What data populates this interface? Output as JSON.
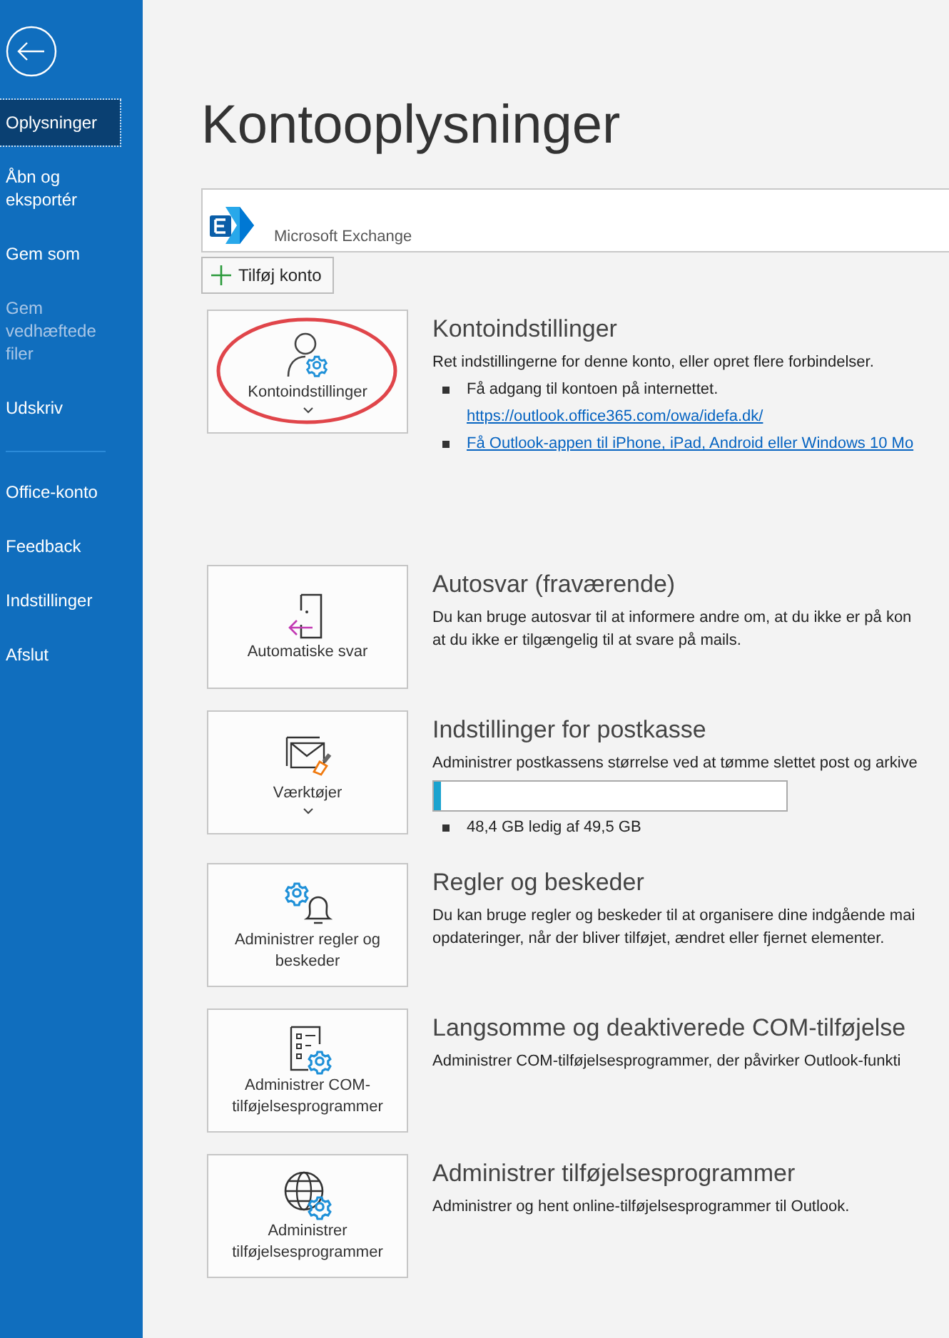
{
  "sidebar": {
    "items": [
      {
        "label": "Oplysninger",
        "selected": true,
        "disabled": false
      },
      {
        "label": "Åbn og eksportér",
        "selected": false,
        "disabled": false
      },
      {
        "label": "Gem som",
        "selected": false,
        "disabled": false
      },
      {
        "label": "Gem vedhæftede filer",
        "selected": false,
        "disabled": true
      },
      {
        "label": "Udskriv",
        "selected": false,
        "disabled": false
      }
    ],
    "bottom_items": [
      {
        "label": "Office-konto",
        "selected": false,
        "disabled": false
      },
      {
        "label": "Feedback",
        "selected": false,
        "disabled": false
      },
      {
        "label": "Indstillinger",
        "selected": false,
        "disabled": false
      },
      {
        "label": "Afslut",
        "selected": false,
        "disabled": false
      }
    ]
  },
  "page_title": "Kontooplysninger",
  "account": {
    "type": "Microsoft Exchange"
  },
  "add_account_button": "Tilføj konto",
  "sections": [
    {
      "kind": "account_settings",
      "button": {
        "label": "Kontoindstillinger",
        "dropdown": true,
        "highlighted": true
      },
      "heading": "Kontoindstillinger",
      "description": "Ret indstillingerne for denne konto, eller opret flere forbindelser.",
      "bullets": [
        {
          "text": "Få adgang til kontoen på internettet.",
          "link": "https://outlook.office365.com/owa/idefa.dk/"
        },
        {
          "link": "Få Outlook-appen til iPhone, iPad, Android eller Windows 10 Mo"
        }
      ]
    },
    {
      "kind": "auto_reply",
      "button": {
        "label": "Automatiske svar",
        "dropdown": false,
        "highlighted": false
      },
      "heading": "Autosvar (fraværende)",
      "description": "Du kan bruge autosvar til at informere andre om, at du ikke er på kon\nat du ikke er tilgængelig til at svare på mails."
    },
    {
      "kind": "tools",
      "button": {
        "label": "Værktøjer",
        "dropdown": true,
        "highlighted": false
      },
      "heading": "Indstillinger for postkasse",
      "description": "Administrer postkassens størrelse ved at tømme slettet post og arkive",
      "storage": {
        "level": 0.022,
        "text": "48,4 GB ledig af 49,5 GB"
      }
    },
    {
      "kind": "rules",
      "button": {
        "label": "Administrer regler og beskeder",
        "dropdown": false,
        "highlighted": false
      },
      "heading": "Regler og beskeder",
      "description": "Du kan bruge regler og beskeder til at organisere dine indgående mai\nopdateringer, når der bliver tilføjet, ændret eller fjernet elementer."
    },
    {
      "kind": "com_addins",
      "button": {
        "label": "Administrer COM-tilføjelsesprogrammer",
        "dropdown": false,
        "highlighted": false
      },
      "heading": "Langsomme og deaktiverede COM-tilføjelse",
      "description": "Administrer COM-tilføjelsesprogrammer, der påvirker Outlook-funkti"
    },
    {
      "kind": "addins",
      "button": {
        "label": "Administrer tilføjelsesprogrammer",
        "dropdown": false,
        "highlighted": false
      },
      "heading": "Administrer tilføjelsesprogrammer",
      "description": "Administrer og hent online-tilføjelsesprogrammer til Outlook."
    }
  ]
}
